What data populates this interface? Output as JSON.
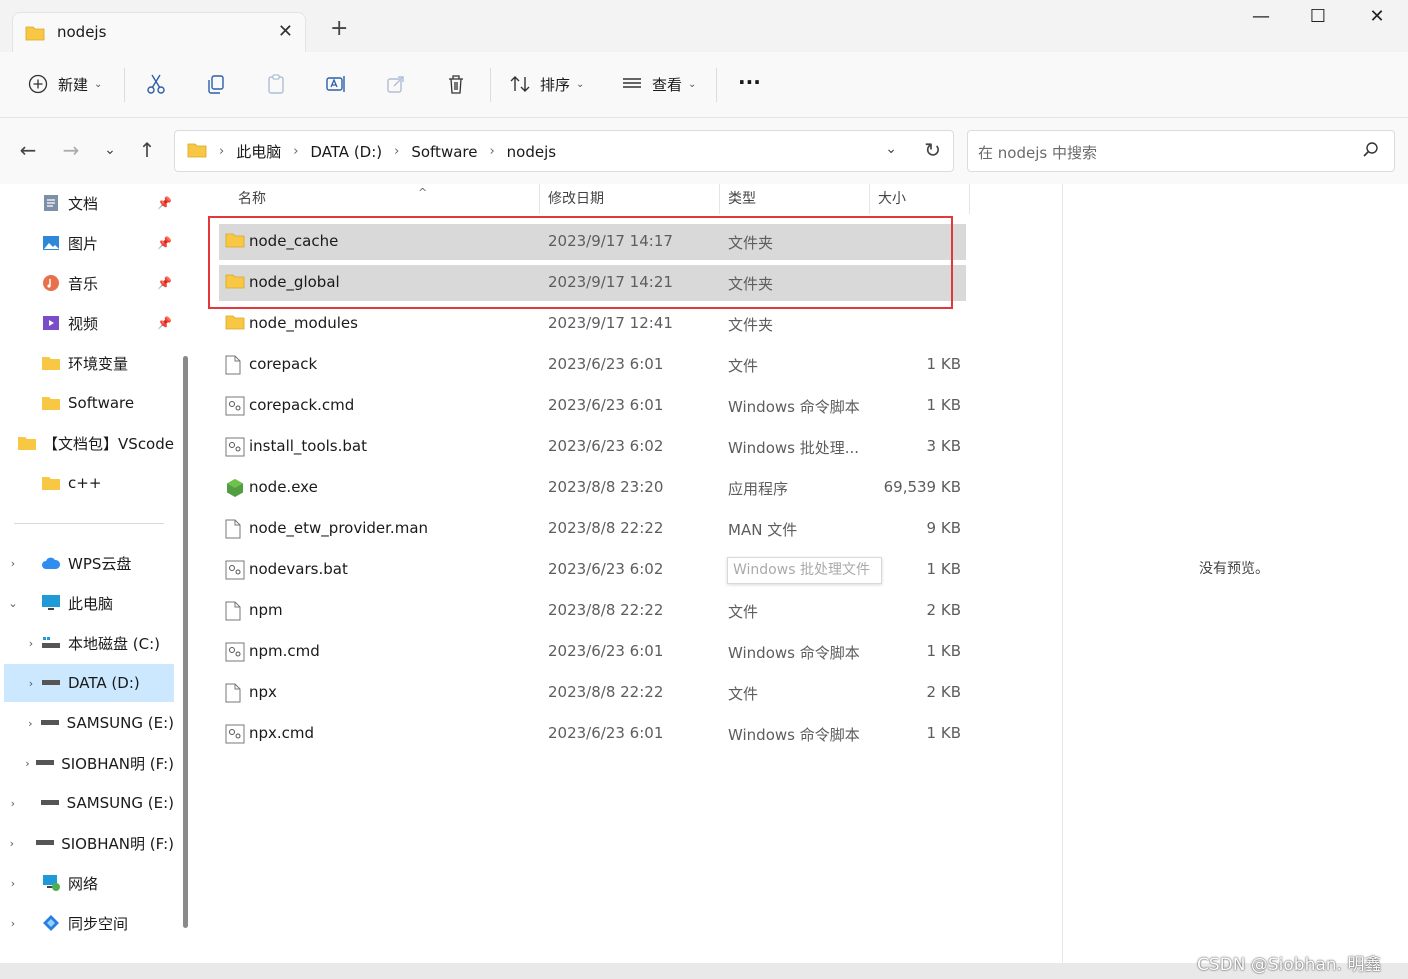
{
  "window": {
    "tab_title": "nodejs",
    "close_tab": "✕",
    "new_tab": "+",
    "minimize": "—",
    "maximize": "☐",
    "close": "✕"
  },
  "toolbar": {
    "new_label": "新建",
    "sort_label": "排序",
    "view_label": "查看",
    "more_label": "···"
  },
  "address": {
    "crumbs": [
      "此电脑",
      "DATA (D:)",
      "Software",
      "nodejs"
    ],
    "search_placeholder": "在 nodejs 中搜索"
  },
  "sidebar": {
    "items": [
      {
        "label": "文档",
        "icon": "documents-icon",
        "pinned": true
      },
      {
        "label": "图片",
        "icon": "pictures-icon",
        "pinned": true
      },
      {
        "label": "音乐",
        "icon": "music-icon",
        "pinned": true
      },
      {
        "label": "视频",
        "icon": "videos-icon",
        "pinned": true
      },
      {
        "label": "环境变量",
        "icon": "folder-icon"
      },
      {
        "label": "Software",
        "icon": "folder-icon"
      },
      {
        "label": "【文档包】VScode",
        "icon": "folder-icon"
      },
      {
        "label": "c++",
        "icon": "folder-icon"
      },
      {
        "label": "WPS云盘",
        "icon": "cloud-icon"
      },
      {
        "label": "此电脑",
        "icon": "computer-icon"
      },
      {
        "label": "本地磁盘 (C:)",
        "icon": "drive-icon"
      },
      {
        "label": "DATA (D:)",
        "icon": "drive-icon"
      },
      {
        "label": "SAMSUNG (E:)",
        "icon": "drive-icon"
      },
      {
        "label": "SIOBHAN明 (F:)",
        "icon": "drive-icon"
      },
      {
        "label": "SAMSUNG (E:)",
        "icon": "drive-icon"
      },
      {
        "label": "SIOBHAN明 (F:)",
        "icon": "drive-icon"
      },
      {
        "label": "网络",
        "icon": "network-icon"
      },
      {
        "label": "同步空间",
        "icon": "sync-icon"
      }
    ]
  },
  "columns": {
    "name": "名称",
    "date": "修改日期",
    "type": "类型",
    "size": "大小"
  },
  "files": [
    {
      "name": "node_cache",
      "date": "2023/9/17 14:17",
      "type": "文件夹",
      "size": "",
      "kind": "folder"
    },
    {
      "name": "node_global",
      "date": "2023/9/17 14:21",
      "type": "文件夹",
      "size": "",
      "kind": "folder"
    },
    {
      "name": "node_modules",
      "date": "2023/9/17 12:41",
      "type": "文件夹",
      "size": "",
      "kind": "folder"
    },
    {
      "name": "corepack",
      "date": "2023/6/23 6:01",
      "type": "文件",
      "size": "1 KB",
      "kind": "file"
    },
    {
      "name": "corepack.cmd",
      "date": "2023/6/23 6:01",
      "type": "Windows 命令脚本",
      "size": "1 KB",
      "kind": "script"
    },
    {
      "name": "install_tools.bat",
      "date": "2023/6/23 6:02",
      "type": "Windows 批处理...",
      "size": "3 KB",
      "kind": "script"
    },
    {
      "name": "node.exe",
      "date": "2023/8/8 23:20",
      "type": "应用程序",
      "size": "69,539 KB",
      "kind": "node"
    },
    {
      "name": "node_etw_provider.man",
      "date": "2023/8/8 22:22",
      "type": "MAN 文件",
      "size": "9 KB",
      "kind": "file"
    },
    {
      "name": "nodevars.bat",
      "date": "2023/6/23 6:02",
      "type": "Windows 批处理",
      "size": "1 KB",
      "kind": "script"
    },
    {
      "name": "npm",
      "date": "2023/8/8 22:22",
      "type": "文件",
      "size": "2 KB",
      "kind": "file"
    },
    {
      "name": "npm.cmd",
      "date": "2023/6/23 6:01",
      "type": "Windows 命令脚本",
      "size": "1 KB",
      "kind": "script"
    },
    {
      "name": "npx",
      "date": "2023/8/8 22:22",
      "type": "文件",
      "size": "2 KB",
      "kind": "file"
    },
    {
      "name": "npx.cmd",
      "date": "2023/6/23 6:01",
      "type": "Windows 命令脚本",
      "size": "1 KB",
      "kind": "script"
    }
  ],
  "tooltip": "Windows 批处理文件",
  "preview": {
    "message": "没有预览。"
  },
  "watermark": "CSDN @Siobhan. 明鑫",
  "colors": {
    "accent": "#0067c0",
    "selection": "#cce8ff",
    "highlight_box": "#e3383b",
    "folder": "#f8c845"
  }
}
